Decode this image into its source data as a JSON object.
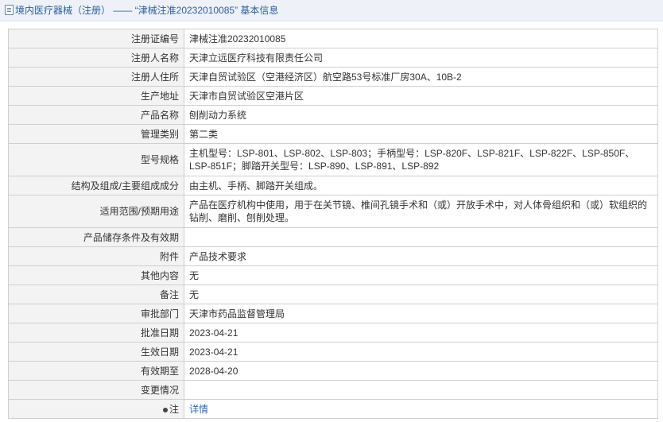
{
  "header": {
    "title": "境内医疗器械（注册） —— “津械注准20232010085” 基本信息"
  },
  "rows": [
    {
      "label": "注册证编号",
      "value": "津械注准20232010085"
    },
    {
      "label": "注册人名称",
      "value": "天津立远医疗科技有限责任公司"
    },
    {
      "label": "注册人住所",
      "value": "天津自贸试验区（空港经济区）航空路53号标准厂房30A、10B-2"
    },
    {
      "label": "生产地址",
      "value": "天津市自贸试验区空港片区"
    },
    {
      "label": "产品名称",
      "value": "刨削动力系统"
    },
    {
      "label": "管理类别",
      "value": "第二类"
    },
    {
      "label": "型号规格",
      "value": "主机型号：LSP-801、LSP-802、LSP-803；手柄型号：LSP-820F、LSP-821F、LSP-822F、LSP-850F、LSP-851F；脚踏开关型号：LSP-890、LSP-891、LSP-892"
    },
    {
      "label": "结构及组成/主要组成成分",
      "value": "由主机、手柄、脚踏开关组成。"
    },
    {
      "label": "适用范围/预期用途",
      "value": "产品在医疗机构中使用，用于在关节镜、椎间孔镜手术和（或）开放手术中，对人体骨组织和（或）软组织的钻削、磨削、刨削处理。"
    },
    {
      "label": "产品储存条件及有效期",
      "value": ""
    },
    {
      "label": "附件",
      "value": "产品技术要求"
    },
    {
      "label": "其他内容",
      "value": "无"
    },
    {
      "label": "备注",
      "value": "无"
    },
    {
      "label": "审批部门",
      "value": "天津市药品监督管理局"
    },
    {
      "label": "批准日期",
      "value": "2023-04-21"
    },
    {
      "label": "生效日期",
      "value": "2023-04-21"
    },
    {
      "label": "有效期至",
      "value": "2028-04-20"
    },
    {
      "label": "变更情况",
      "value": ""
    }
  ],
  "footer_row": {
    "label": "注",
    "link": "详情"
  },
  "colors": {
    "header_bg": "#eef1f7",
    "header_text": "#2b5f9e",
    "label_bg": "#f3f3f3",
    "border": "#cfcfcf",
    "link": "#2a6dbf"
  }
}
